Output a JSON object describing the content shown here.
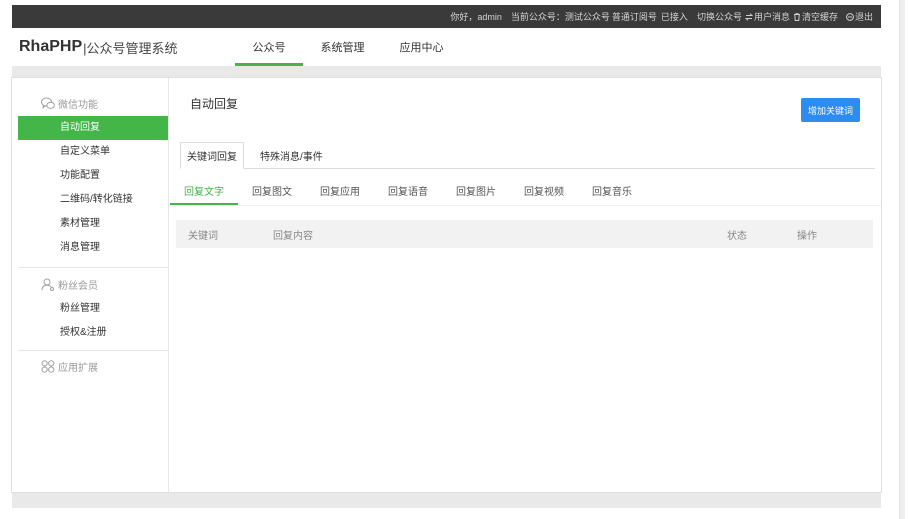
{
  "colors": {
    "accent": "#44b549",
    "primary": "#2d8cf0",
    "topbar": "#3a3a3a",
    "page_bg": "#e9e9e9"
  },
  "topbar": {
    "greeting": "你好，admin",
    "current_account": "当前公众号：测试公众号",
    "account_type": "普通订阅号",
    "account_status": "已接入",
    "switch_account": "切换公众号",
    "user_messages": {
      "icon": "transfer-icon",
      "label": "用户消息"
    },
    "clear_cache": {
      "icon": "trash-icon",
      "label": "清空缓存"
    },
    "logout": {
      "icon": "logout-icon",
      "label": "退出"
    }
  },
  "header": {
    "logo": "RhaPHP",
    "subtitle": "|公众号管理系统",
    "nav": [
      {
        "label": "公众号",
        "active": true
      },
      {
        "label": "系统管理",
        "active": false
      },
      {
        "label": "应用中心",
        "active": false
      }
    ]
  },
  "sidebar": {
    "sections": [
      {
        "title": "微信功能",
        "icon": "wechat-icon",
        "items": [
          {
            "label": "自动回复",
            "active": true
          },
          {
            "label": "自定义菜单",
            "active": false
          },
          {
            "label": "功能配置",
            "active": false
          },
          {
            "label": "二维码/转化链接",
            "active": false
          },
          {
            "label": "素材管理",
            "active": false
          },
          {
            "label": "消息管理",
            "active": false
          }
        ]
      },
      {
        "title": "粉丝会员",
        "icon": "user-icon",
        "items": [
          {
            "label": "粉丝管理",
            "active": false
          },
          {
            "label": "授权&注册",
            "active": false
          }
        ]
      },
      {
        "title": "应用扩展",
        "icon": "apps-icon",
        "items": []
      }
    ]
  },
  "main": {
    "title": "自动回复",
    "add_button": "增加关键词",
    "tabs": [
      {
        "label": "关键词回复",
        "active": true
      },
      {
        "label": "特殊消息/事件",
        "active": false
      }
    ],
    "reply_types": [
      {
        "label": "回复文字",
        "active": true
      },
      {
        "label": "回复图文",
        "active": false
      },
      {
        "label": "回复应用",
        "active": false
      },
      {
        "label": "回复语音",
        "active": false
      },
      {
        "label": "回复图片",
        "active": false
      },
      {
        "label": "回复视频",
        "active": false
      },
      {
        "label": "回复音乐",
        "active": false
      }
    ],
    "table": {
      "columns": [
        "关键词",
        "回复内容",
        "状态",
        "操作"
      ],
      "rows": []
    }
  }
}
